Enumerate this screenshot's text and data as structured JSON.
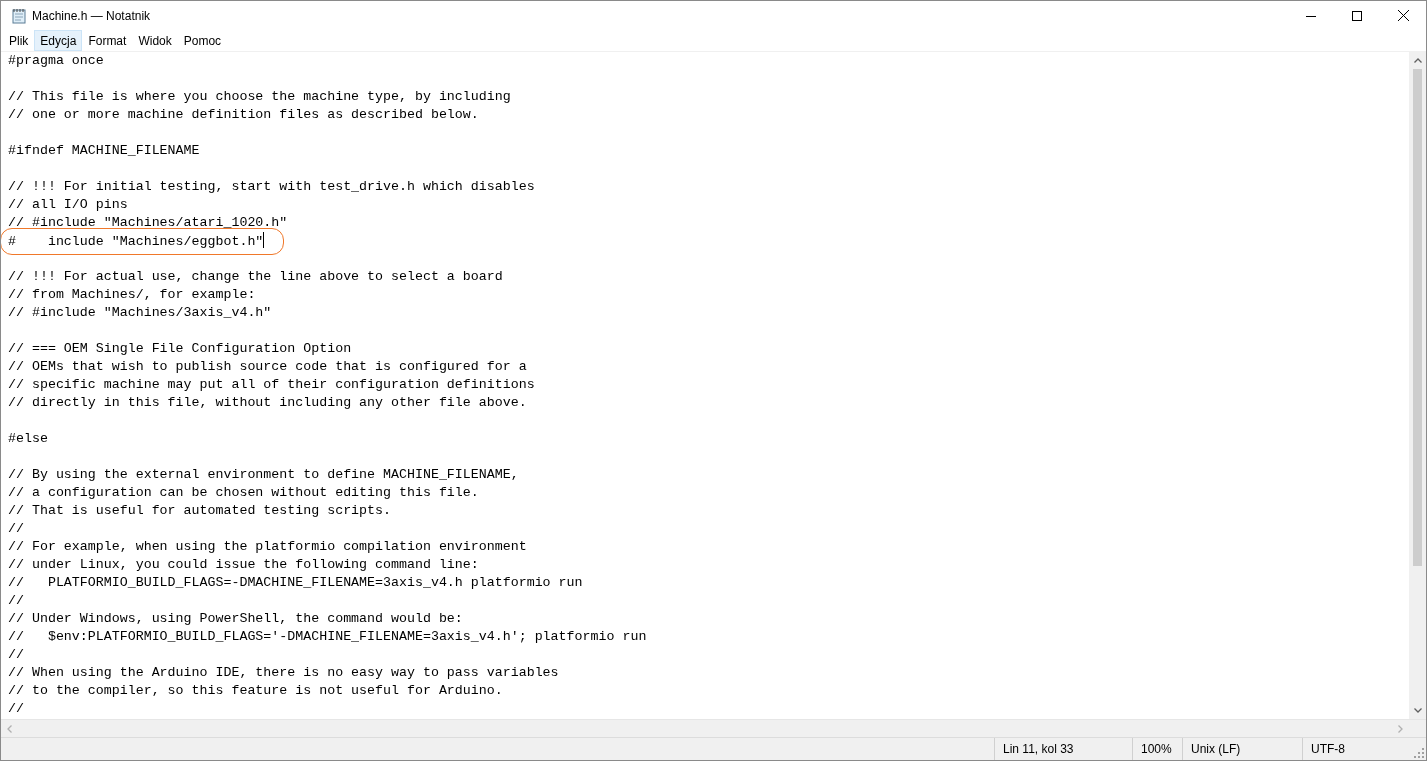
{
  "window": {
    "title": "Machine.h — Notatnik"
  },
  "menu": [
    {
      "label": "Plik",
      "selected": false
    },
    {
      "label": "Edycja",
      "selected": true
    },
    {
      "label": "Format",
      "selected": false
    },
    {
      "label": "Widok",
      "selected": false
    },
    {
      "label": "Pomoc",
      "selected": false
    }
  ],
  "lines": [
    {
      "kind": "code",
      "text": "#pragma once",
      "circled": false,
      "cursor": false
    },
    {
      "kind": "blank"
    },
    {
      "kind": "code",
      "text": "// This file is where you choose the machine type, by including",
      "circled": false,
      "cursor": false
    },
    {
      "kind": "code",
      "text": "// one or more machine definition files as described below.",
      "circled": false,
      "cursor": false
    },
    {
      "kind": "blank"
    },
    {
      "kind": "code",
      "text": "#ifndef MACHINE_FILENAME",
      "circled": false,
      "cursor": false
    },
    {
      "kind": "blank"
    },
    {
      "kind": "code",
      "text": "// !!! For initial testing, start with test_drive.h which disables",
      "circled": false,
      "cursor": false
    },
    {
      "kind": "code",
      "text": "// all I/O pins",
      "circled": false,
      "cursor": false
    },
    {
      "kind": "code",
      "text": "// #include \"Machines/atari_1020.h\"",
      "circled": false,
      "cursor": false
    },
    {
      "kind": "code",
      "text": "#    include \"Machines/eggbot.h\"",
      "circled": true,
      "cursor": true
    },
    {
      "kind": "blank"
    },
    {
      "kind": "code",
      "text": "// !!! For actual use, change the line above to select a board",
      "circled": false,
      "cursor": false
    },
    {
      "kind": "code",
      "text": "// from Machines/, for example:",
      "circled": false,
      "cursor": false
    },
    {
      "kind": "code",
      "text": "// #include \"Machines/3axis_v4.h\"",
      "circled": false,
      "cursor": false
    },
    {
      "kind": "blank"
    },
    {
      "kind": "code",
      "text": "// === OEM Single File Configuration Option",
      "circled": false,
      "cursor": false
    },
    {
      "kind": "code",
      "text": "// OEMs that wish to publish source code that is configured for a",
      "circled": false,
      "cursor": false
    },
    {
      "kind": "code",
      "text": "// specific machine may put all of their configuration definitions",
      "circled": false,
      "cursor": false
    },
    {
      "kind": "code",
      "text": "// directly in this file, without including any other file above.",
      "circled": false,
      "cursor": false
    },
    {
      "kind": "blank"
    },
    {
      "kind": "code",
      "text": "#else",
      "circled": false,
      "cursor": false
    },
    {
      "kind": "blank"
    },
    {
      "kind": "code",
      "text": "// By using the external environment to define MACHINE_FILENAME,",
      "circled": false,
      "cursor": false
    },
    {
      "kind": "code",
      "text": "// a configuration can be chosen without editing this file.",
      "circled": false,
      "cursor": false
    },
    {
      "kind": "code",
      "text": "// That is useful for automated testing scripts.",
      "circled": false,
      "cursor": false
    },
    {
      "kind": "code",
      "text": "//",
      "circled": false,
      "cursor": false
    },
    {
      "kind": "code",
      "text": "// For example, when using the platformio compilation environment",
      "circled": false,
      "cursor": false
    },
    {
      "kind": "code",
      "text": "// under Linux, you could issue the following command line:",
      "circled": false,
      "cursor": false
    },
    {
      "kind": "code",
      "text": "//   PLATFORMIO_BUILD_FLAGS=-DMACHINE_FILENAME=3axis_v4.h platformio run",
      "circled": false,
      "cursor": false
    },
    {
      "kind": "code",
      "text": "//",
      "circled": false,
      "cursor": false
    },
    {
      "kind": "code",
      "text": "// Under Windows, using PowerShell, the command would be:",
      "circled": false,
      "cursor": false
    },
    {
      "kind": "code",
      "text": "//   $env:PLATFORMIO_BUILD_FLAGS='-DMACHINE_FILENAME=3axis_v4.h'; platformio run",
      "circled": false,
      "cursor": false
    },
    {
      "kind": "code",
      "text": "//",
      "circled": false,
      "cursor": false
    },
    {
      "kind": "code",
      "text": "// When using the Arduino IDE, there is no easy way to pass variables",
      "circled": false,
      "cursor": false
    },
    {
      "kind": "code",
      "text": "// to the compiler, so this feature is not useful for Arduino.",
      "circled": false,
      "cursor": false
    },
    {
      "kind": "code",
      "text": "//",
      "circled": false,
      "cursor": false
    }
  ],
  "status_bar": {
    "position": "Lin 11, kol 33",
    "zoom": "100%",
    "line_endings": "Unix (LF)",
    "encoding": "UTF-8"
  }
}
